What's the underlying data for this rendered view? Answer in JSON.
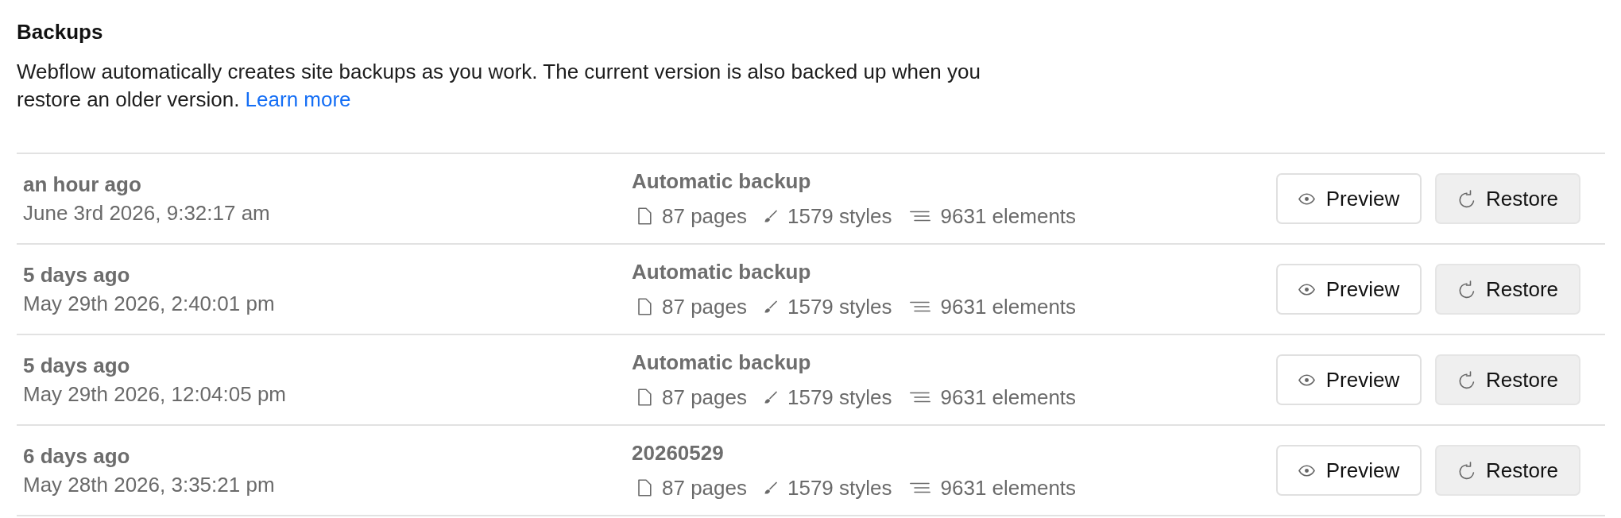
{
  "section": {
    "title": "Backups",
    "description": "Webflow automatically creates site backups as you work. The current version is also backed up when you restore an older version.",
    "link": "Learn more"
  },
  "backups": [
    {
      "relative_time": "an hour ago",
      "timestamp": "June 3rd 2026, 9:32:17 am",
      "name": "Automatic backup",
      "pages": "87 pages",
      "styles": "1579 styles",
      "elements": "9631 elements",
      "actions": [
        {
          "kind": "preview",
          "label": "Preview"
        },
        {
          "kind": "restore",
          "label": "Restore"
        }
      ]
    },
    {
      "relative_time": "5 days ago",
      "timestamp": "May 29th 2026, 2:40:01 pm",
      "name": "Automatic backup",
      "pages": "87 pages",
      "styles": "1579 styles",
      "elements": "9631 elements",
      "actions": [
        {
          "kind": "preview",
          "label": "Preview"
        },
        {
          "kind": "restore",
          "label": "Restore"
        }
      ]
    },
    {
      "relative_time": "5 days ago",
      "timestamp": "May 29th 2026, 12:04:05 pm",
      "name": "Automatic backup",
      "pages": "87 pages",
      "styles": "1579 styles",
      "elements": "9631 elements",
      "actions": [
        {
          "kind": "preview",
          "label": "Preview"
        },
        {
          "kind": "restore",
          "label": "Restore"
        }
      ]
    },
    {
      "relative_time": "6 days ago",
      "timestamp": "May 28th 2026, 3:35:21 pm",
      "name": "20260529",
      "pages": "87 pages",
      "styles": "1579 styles",
      "elements": "9631 elements",
      "actions": [
        {
          "kind": "preview",
          "label": "Preview"
        },
        {
          "kind": "restore",
          "label": "Restore"
        }
      ]
    }
  ]
}
